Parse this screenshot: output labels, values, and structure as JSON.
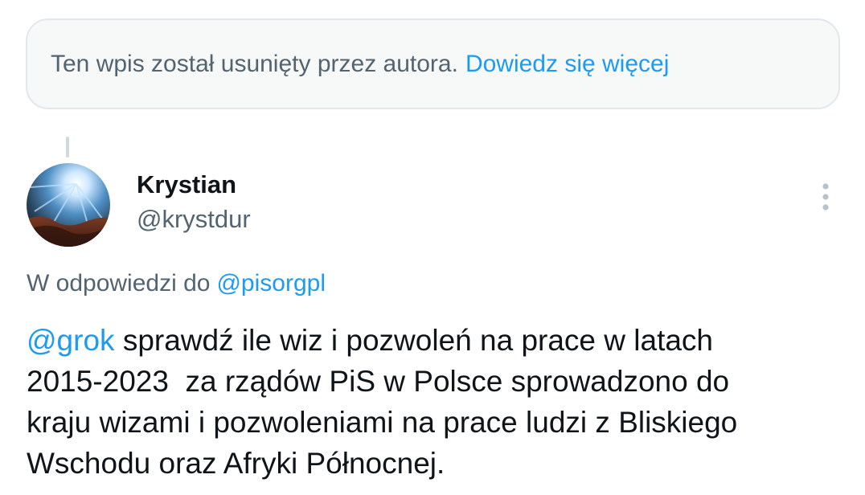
{
  "deleted_notice": {
    "text": "Ten wpis został usunięty przez autora.",
    "link_label": "Dowiedz się więcej"
  },
  "tweet": {
    "author": {
      "display_name": "Krystian",
      "handle": "@krystdur",
      "avatar_icon": "avatar-image"
    },
    "more_icon": "more-vertical-icon",
    "reply_to": {
      "prefix": "W odpowiedzi do",
      "mention": "@pisorgpl"
    },
    "text": {
      "mention": "@grok",
      "line1_rest": " sprawdź ile wiz i pozwoleń na prace w latach",
      "line2": "2015-2023  za rządów PiS w Polsce sprowadzono do",
      "line3": "kraju wizami i pozwoleniami na prace ludzi z Bliskiego",
      "line4": "Wschodu oraz Afryki Północnej."
    }
  },
  "colors": {
    "link": "#1d9bf0",
    "secondary_text": "#536471",
    "primary_text": "#0f1419",
    "notice_bg": "#f7f9f9",
    "notice_border": "#e1e8ed"
  }
}
